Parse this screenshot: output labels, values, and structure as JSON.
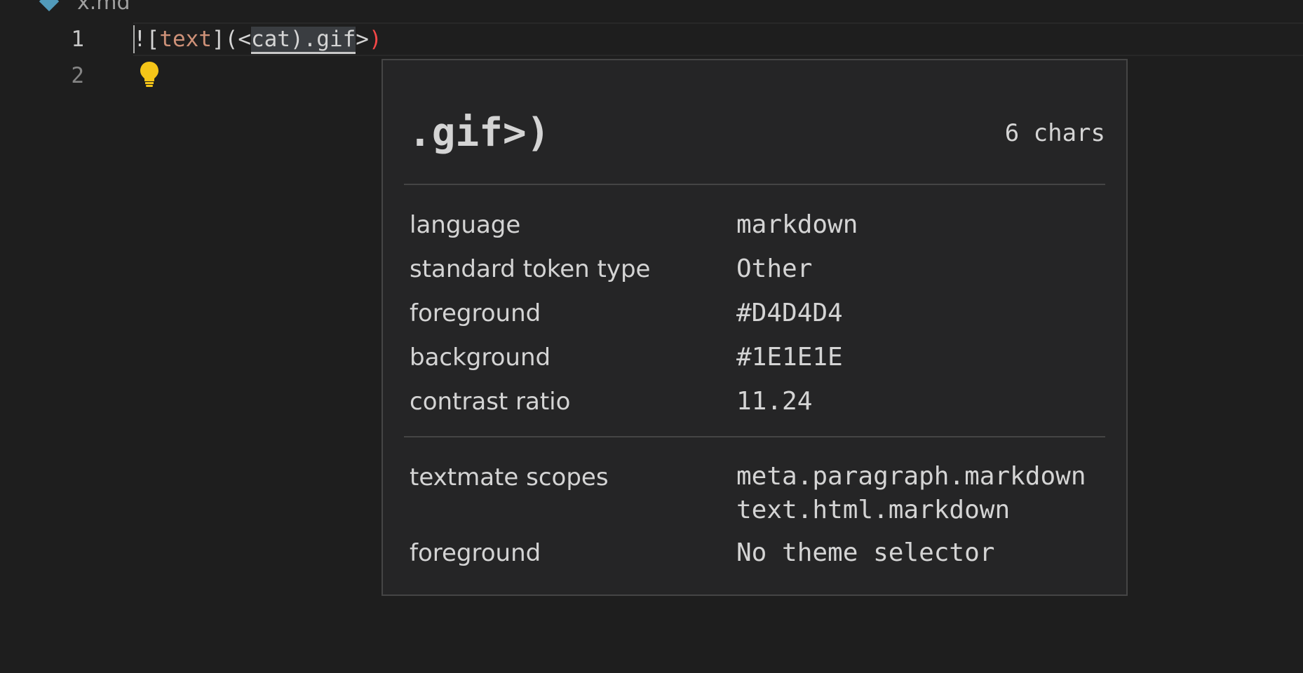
{
  "tab": {
    "label": "x.md",
    "icon": "markdown-file-icon"
  },
  "gutter": {
    "line1": "1",
    "line2": "2"
  },
  "code": {
    "line1": {
      "bang_open": "![",
      "alt_text": "text",
      "close_open": "](",
      "lt": "<",
      "hovered_pre": "cat).gif",
      "gt": ">",
      "paren_close": ")"
    }
  },
  "hover": {
    "token": ".gif>)",
    "char_count": "6 chars",
    "properties": [
      {
        "key": "language",
        "value": "markdown"
      },
      {
        "key": "standard token type",
        "value": "Other"
      },
      {
        "key": "foreground",
        "value": "#D4D4D4"
      },
      {
        "key": "background",
        "value": "#1E1E1E"
      },
      {
        "key": "contrast ratio",
        "value": "11.24"
      }
    ],
    "scopes": {
      "key": "textmate scopes",
      "values": [
        "meta.paragraph.markdown",
        "text.html.markdown"
      ]
    },
    "theme": {
      "key": "foreground",
      "value": "No theme selector"
    }
  },
  "colors": {
    "editor_bg": "#1e1e1e",
    "widget_bg": "#252526",
    "widget_border": "#454545",
    "text": "#d4d4d4",
    "string": "#ce9178",
    "error_paren": "#f44747",
    "bulb": "#f5c518"
  }
}
